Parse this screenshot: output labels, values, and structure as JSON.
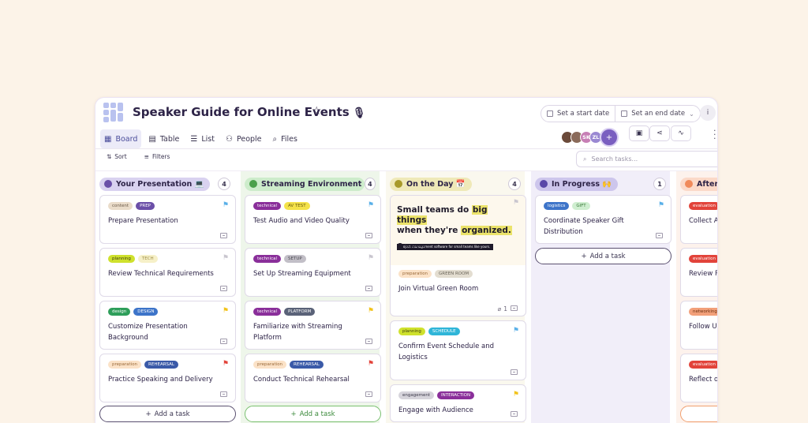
{
  "header": {
    "title": "Speaker Guide for Online Events",
    "title_icon": "🎙",
    "star_icon": "star-icon",
    "start_date_label": "Set a start date",
    "end_date_label": "Set an end date",
    "info_label": "i"
  },
  "nav": {
    "tabs": [
      {
        "label": "Board",
        "icon": "board-icon",
        "glyph": "▦"
      },
      {
        "label": "Table",
        "icon": "table-icon",
        "glyph": "▤"
      },
      {
        "label": "List",
        "icon": "list-icon",
        "glyph": "☰"
      },
      {
        "label": "People",
        "icon": "people-icon",
        "glyph": "⚇"
      },
      {
        "label": "Files",
        "icon": "paperclip-icon",
        "glyph": "⌕"
      }
    ]
  },
  "avatars": [
    {
      "initials": "",
      "color": "#6b4a3a"
    },
    {
      "initials": "",
      "color": "#8a6a5a"
    },
    {
      "initials": "SK",
      "color": "#c77fb5"
    },
    {
      "initials": "ZL",
      "color": "#9a88d2"
    }
  ],
  "toolbar": {
    "sort_label": "Sort",
    "filters_label": "Filters",
    "search_placeholder": "Search tasks..."
  },
  "columns": [
    {
      "title": "Your Presentation 💻",
      "count": "4",
      "pill_color": "#d9d2f0",
      "dot_color": "#6a4fa8",
      "bg": "#ffffff",
      "add_label": "Add a task",
      "add_border": "#5a5070",
      "add_color": "#3a3450",
      "cards": [
        {
          "title": "Prepare Presentation",
          "flag_color": "#5ab0e8",
          "labels": [
            {
              "text": "content",
              "bg": "#eadcca",
              "fg": "#6a5a48"
            },
            {
              "text": "PREP",
              "bg": "#6b4fa8",
              "fg": "#ffffff"
            }
          ]
        },
        {
          "title": "Review Technical Requirements",
          "flag_color": "#c9c6cf",
          "labels": [
            {
              "text": "planning",
              "bg": "#cfe12d",
              "fg": "#3a3a10"
            },
            {
              "text": "TECH",
              "bg": "#f6f0c8",
              "fg": "#a09048"
            }
          ]
        },
        {
          "title": "Customize Presentation Background",
          "flag_color": "#f2c31b",
          "labels": [
            {
              "text": "design",
              "bg": "#2e9e5a",
              "fg": "#ffffff"
            },
            {
              "text": "DESIGN",
              "bg": "#3d74c9",
              "fg": "#ffffff"
            }
          ]
        },
        {
          "title": "Practice Speaking and Delivery",
          "flag_color": "#e2433a",
          "labels": [
            {
              "text": "preparation",
              "bg": "#fbe2c7",
              "fg": "#9a6a3a"
            },
            {
              "text": "REHEARSAL",
              "bg": "#3a5aa8",
              "fg": "#ffffff"
            }
          ]
        }
      ]
    },
    {
      "title": "Streaming Environment 🎥",
      "count": "4",
      "pill_color": "#cdeccb",
      "dot_color": "#4aa04a",
      "bg": "#eef6ea",
      "add_label": "Add a task",
      "add_border": "#7ac070",
      "add_color": "#3c8a3c",
      "cards": [
        {
          "title": "Test Audio and Video Quality",
          "flag_color": "#5ab0e8",
          "labels": [
            {
              "text": "technical",
              "bg": "#8a2f9a",
              "fg": "#ffffff"
            },
            {
              "text": "AV TEST",
              "bg": "#f4e24a",
              "fg": "#6a5a10"
            }
          ]
        },
        {
          "title": "Set Up Streaming Equipment",
          "flag_color": "#c9c6cf",
          "labels": [
            {
              "text": "technical",
              "bg": "#8a2f9a",
              "fg": "#ffffff"
            },
            {
              "text": "SETUP",
              "bg": "#c2bfc7",
              "fg": "#4a4850"
            }
          ]
        },
        {
          "title": "Familiarize with Streaming Platform",
          "flag_color": "#f2c31b",
          "labels": [
            {
              "text": "technical",
              "bg": "#8a2f9a",
              "fg": "#ffffff"
            },
            {
              "text": "PLATFORM",
              "bg": "#5a6278",
              "fg": "#ffffff"
            }
          ]
        },
        {
          "title": "Conduct Technical Rehearsal",
          "flag_color": "#e2433a",
          "labels": [
            {
              "text": "preparation",
              "bg": "#fbe2c7",
              "fg": "#9a6a3a"
            },
            {
              "text": "REHEARSAL",
              "bg": "#3a5aa8",
              "fg": "#ffffff"
            }
          ]
        }
      ]
    },
    {
      "title": "On the Day 📅",
      "count": "4",
      "pill_color": "#efe9b8",
      "dot_color": "#a89a2a",
      "bg": "#faf8ee",
      "cover": {
        "headline_a": "Small teams do ",
        "headline_hl1": "big things",
        "headline_b": "when they're ",
        "headline_hl2": "organized.",
        "bar_text": "Project management software for small teams like yours.",
        "logo_text": "teamhub"
      },
      "cards": [
        {
          "title": "Join Virtual Green Room",
          "flag_color": "#c9c6cf",
          "attachments": "1",
          "labels": [
            {
              "text": "preparation",
              "bg": "#fbe2c7",
              "fg": "#9a6a3a"
            },
            {
              "text": "GREEN ROOM",
              "bg": "#e3ddd0",
              "fg": "#6a6458"
            }
          ]
        },
        {
          "title": "Confirm Event Schedule and Logistics",
          "flag_color": "#5ab0e8",
          "labels": [
            {
              "text": "planning",
              "bg": "#cfe12d",
              "fg": "#3a3a10"
            },
            {
              "text": "SCHEDULE",
              "bg": "#2fb5d8",
              "fg": "#ffffff"
            }
          ]
        },
        {
          "title": "Engage with Audience",
          "flag_color": "#f2c31b",
          "labels": [
            {
              "text": "engagement",
              "bg": "#d6d4db",
              "fg": "#3a3848"
            },
            {
              "text": "INTERACTION",
              "bg": "#8a2f9a",
              "fg": "#ffffff"
            }
          ]
        }
      ]
    },
    {
      "title": "In Progress 🙌",
      "count": "1",
      "pill_color": "#cdc6ec",
      "dot_color": "#5a48a8",
      "bg": "#f1eef9",
      "add_label": "Add a task",
      "add_border": "#5a5070",
      "add_color": "#3a3450",
      "cards": [
        {
          "title": "Coordinate Speaker Gift Distribution",
          "flag_color": "#5ab0e8",
          "labels": [
            {
              "text": "logistics",
              "bg": "#3d74c9",
              "fg": "#ffffff"
            },
            {
              "text": "GIFT",
              "bg": "#cfeed0",
              "fg": "#3a7a3a"
            }
          ]
        }
      ]
    },
    {
      "title": "After",
      "count": "",
      "pill_color": "#fbd9c8",
      "dot_color": "#f08a5a",
      "bg": "#fdf2ec",
      "add_label": "",
      "add_border": "#f0a070",
      "add_color": "#d07040",
      "cards": [
        {
          "title": "Collect Audience Feedback",
          "flag_color": "",
          "labels": [
            {
              "text": "evaluation",
              "bg": "#e2433a",
              "fg": "#ffffff"
            }
          ]
        },
        {
          "title": "Review Recording",
          "flag_color": "",
          "labels": [
            {
              "text": "evaluation",
              "bg": "#e2433a",
              "fg": "#ffffff"
            }
          ]
        },
        {
          "title": "Follow Up with Contacts",
          "flag_color": "",
          "labels": [
            {
              "text": "networking",
              "bg": "#f2a07a",
              "fg": "#6a3010"
            }
          ]
        },
        {
          "title": "Reflect on Performance",
          "flag_color": "",
          "labels": [
            {
              "text": "evaluation",
              "bg": "#e2433a",
              "fg": "#ffffff"
            }
          ]
        }
      ]
    }
  ]
}
